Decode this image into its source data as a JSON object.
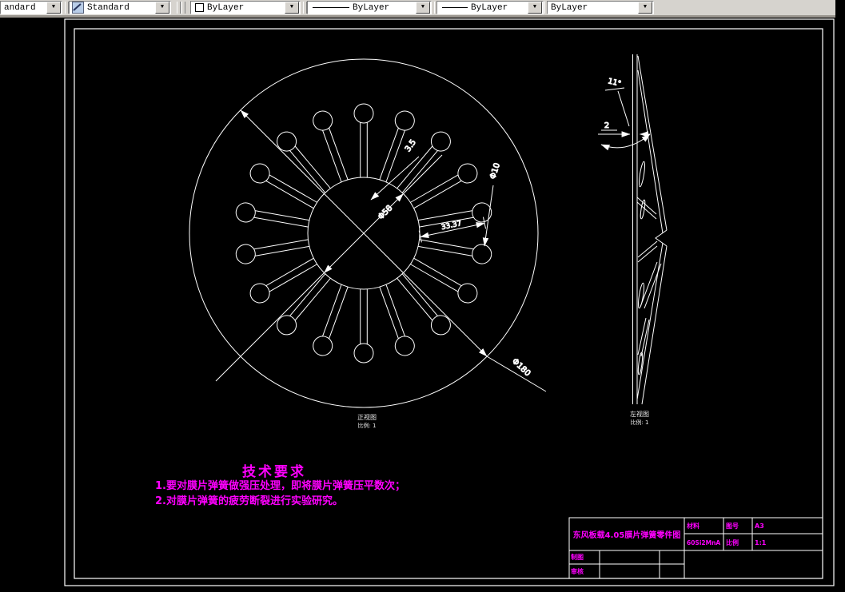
{
  "toolbar": {
    "combos": [
      {
        "label": "andard",
        "icon": "none"
      },
      {
        "label": "Standard",
        "icon": "text-style"
      },
      {
        "label": "ByLayer",
        "icon": "color-swatch"
      },
      {
        "label": "ByLayer",
        "icon": "linetype-line"
      },
      {
        "label": "ByLayer",
        "icon": "lineweight-line"
      },
      {
        "label": "ByLayer",
        "icon": "none"
      }
    ],
    "arrow_glyph": "▼"
  },
  "front_view": {
    "label": "正视图",
    "scale": "比例: 1",
    "dims": {
      "outer_diameter": "Φ180",
      "inner_diameter": "Φ58",
      "slot_width": "3.5",
      "slot_length": "33.37",
      "window_diameter": "Φ10"
    }
  },
  "side_view": {
    "label": "左视图",
    "scale": "比例: 1",
    "dims": {
      "cone_angle": "11°",
      "thickness": "2"
    }
  },
  "tech_req": {
    "title": "技术要求",
    "items": [
      "1.要对膜片弹簧做强压处理，即将膜片弹簧压平数次；",
      "2.对膜片弹簧的疲劳断裂进行实验研究。"
    ]
  },
  "title_block": {
    "drawing_title": "东风板载4.05膜片弹簧零件图",
    "material_label": "材料",
    "material_value": "60Si2MnA",
    "sheet_label": "图号",
    "sheet_value": "A3",
    "scale_label": "比例",
    "scale_value": "1:1",
    "drafter_label": "制图",
    "checker_label": "审核"
  },
  "colors": {
    "line": "#ffffff",
    "annotation": "#ff00ff",
    "toolbar_bg": "#d6d3ce"
  }
}
